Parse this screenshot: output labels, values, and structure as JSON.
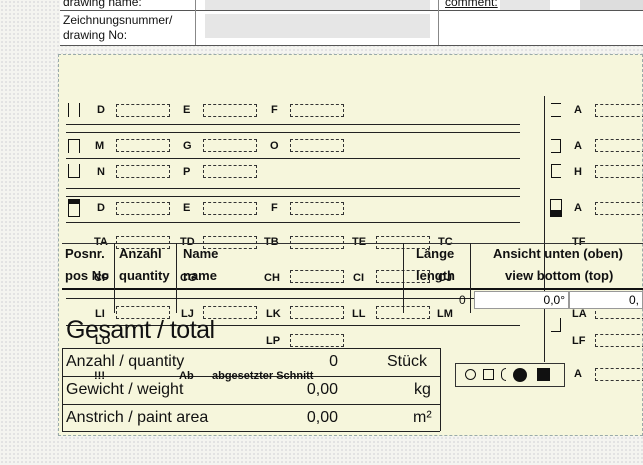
{
  "header": {
    "drawing_name_label": "drawing name:",
    "drawing_no_label_1": "Zeichnungsnummer/",
    "drawing_no_label_2": "drawing No:",
    "comment_label": "comment:"
  },
  "profile_rows": [
    {
      "letters": [
        "D",
        "E",
        "F"
      ]
    },
    {
      "letters": [
        "M",
        "G",
        "O"
      ]
    },
    {
      "letters": [
        "N",
        "P"
      ]
    },
    {
      "letters": [
        "D",
        "E",
        "F"
      ]
    },
    {
      "letters": [
        "TA",
        "TD",
        "TB",
        "TE",
        "TC"
      ]
    },
    {
      "letters": [
        "CF",
        "CG",
        "CH",
        "CI",
        "CJ"
      ]
    },
    {
      "letters": [
        "LI",
        "LJ",
        "LK",
        "LL",
        "LM"
      ]
    },
    {
      "letters": [
        "LO",
        "LP"
      ]
    }
  ],
  "right_column": {
    "letters": [
      "A",
      "A",
      "H",
      "A",
      "TF",
      "LA",
      "LF"
    ]
  },
  "table": {
    "posnr_1": "Posnr.",
    "posnr_2": "pos No",
    "anzahl_1": "Anzahl",
    "anzahl_2": "quantity",
    "name_1": "Name",
    "name_2": "name",
    "laenge_1": "Länge",
    "laenge_2": "length",
    "ansicht_1": "Ansicht unten (oben)",
    "ansicht_2": "view bottom (top)",
    "length_value": "0",
    "angle_value": "0,0°",
    "angle_value_2": "0,"
  },
  "summary": {
    "title": "Gesamt / total",
    "quantity_label": "Anzahl / quantity",
    "quantity_value": "0",
    "quantity_unit": "Stück",
    "weight_label": "Gewicht / weight",
    "weight_value": "0,00",
    "weight_unit": "kg",
    "paint_label": "Anstrich / paint area",
    "paint_value": "0,00",
    "paint_unit": "m²",
    "note_excl": "!!!",
    "note_ab": "Ab",
    "note_cut": "abgesetzter Schnitt"
  }
}
